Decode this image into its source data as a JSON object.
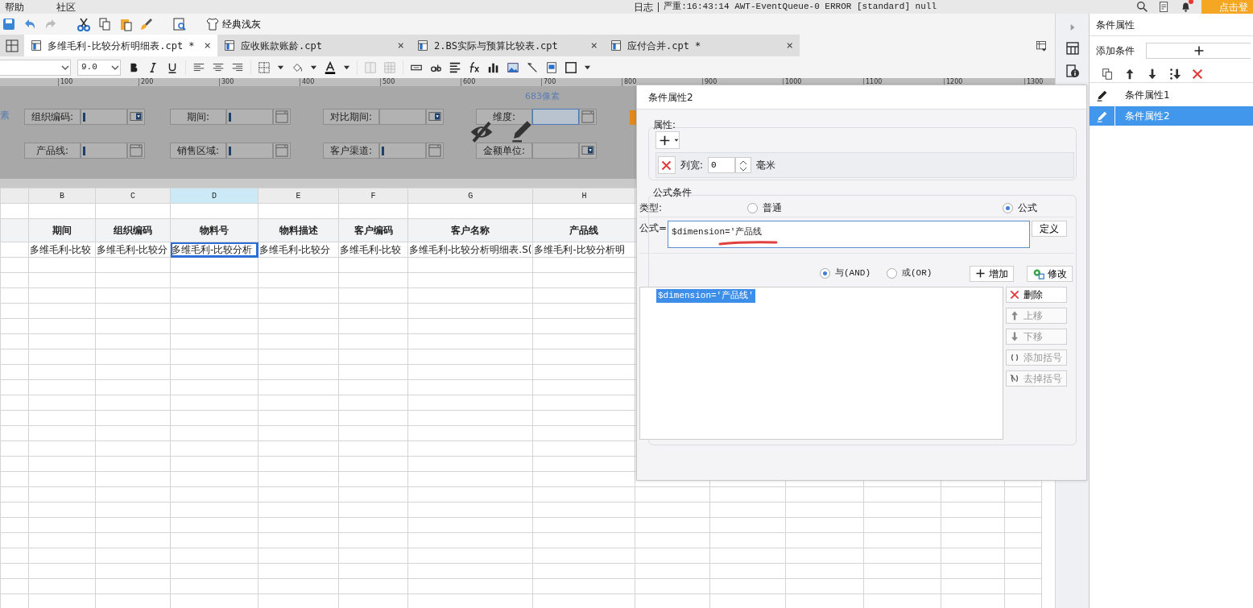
{
  "menu": [
    {
      "label": "帮助"
    },
    {
      "label": "社区"
    }
  ],
  "log": {
    "label": "日志",
    "message": "严重:16:43:14 AWT-EventQueue-0 ERROR [standard] null"
  },
  "notification": {
    "unread": true
  },
  "login_button": "点击登",
  "toolbar": {
    "redo_disabled": true,
    "theme": "经典浅灰"
  },
  "tabs": [
    {
      "label": "多维毛利-比较分析明细表.cpt *",
      "close": "×",
      "selected": true
    },
    {
      "label": "应收账款账龄.cpt",
      "close": "×",
      "selected": false
    },
    {
      "label": "2.BS实际与预算比较表.cpt",
      "close": "×",
      "selected": false
    },
    {
      "label": "应付合并.cpt *",
      "close": "×",
      "selected": false
    }
  ],
  "format": {
    "font_size": "9.0"
  },
  "ruler": [
    "100",
    "200",
    "300",
    "400",
    "500",
    "600",
    "700",
    "800",
    "900",
    "1000",
    "1100",
    "1200",
    "1300"
  ],
  "parameters": {
    "edge_text": "素",
    "size_hint": "683像素",
    "fields": [
      {
        "label": "组织编码:",
        "kind": "combo",
        "selected": false
      },
      {
        "label": "期间:",
        "kind": "date",
        "selected": false
      },
      {
        "label": "对比期间:",
        "kind": "combo",
        "selected": false
      },
      {
        "label": "维度:",
        "kind": "date",
        "selected": true
      },
      {
        "label": "产品线:",
        "kind": "date",
        "selected": false
      },
      {
        "label": "销售区域:",
        "kind": "date",
        "selected": false
      },
      {
        "label": "客户渠道:",
        "kind": "date",
        "selected": false
      },
      {
        "label": "金额单位:",
        "kind": "combo",
        "selected": false
      }
    ]
  },
  "sheet": {
    "columns": [
      {
        "letter": "B",
        "selected": false
      },
      {
        "letter": "C",
        "selected": false
      },
      {
        "letter": "D",
        "selected": true
      },
      {
        "letter": "E",
        "selected": false
      },
      {
        "letter": "F",
        "selected": false
      },
      {
        "letter": "G",
        "selected": false
      },
      {
        "letter": "H",
        "selected": false
      }
    ],
    "headers": [
      "期间",
      "组织编码",
      "物料号",
      "物料描述",
      "客户编码",
      "客户名称",
      "产品线"
    ],
    "data_row": [
      {
        "text": "多维毛利-比较",
        "selected": false
      },
      {
        "text": "多维毛利-比较分",
        "selected": false
      },
      {
        "text": "多维毛利-比较分析",
        "selected": true
      },
      {
        "text": "多维毛利-比较分",
        "selected": false
      },
      {
        "text": "多维毛利-比较",
        "selected": false
      },
      {
        "text": "多维毛利-比较分析明细表.S(",
        "selected": false
      },
      {
        "text": "多维毛利-比较分析明",
        "selected": false
      }
    ]
  },
  "dialog": {
    "title": "条件属性2",
    "property_section": "属性:",
    "column_width": {
      "label": "列宽:",
      "value": "0",
      "unit": "毫米"
    },
    "formula_section": "公式条件",
    "type_label": "类型:",
    "types": [
      {
        "label": "普通",
        "selected": false
      },
      {
        "label": "公式",
        "selected": true
      }
    ],
    "formula_label": "公式=",
    "formula": "$dimension='产品线",
    "define_button": "定义",
    "joins": [
      {
        "label": "与(AND)",
        "selected": true
      },
      {
        "label": "或(OR)",
        "selected": false
      }
    ],
    "add_button": "增加",
    "modify_button": "修改",
    "conditions": [
      {
        "text": "$dimension='产品线'",
        "selected": true
      }
    ],
    "side_buttons": [
      {
        "label": "删除",
        "kind": "delete",
        "disabled": false
      },
      {
        "label": "上移",
        "kind": "up",
        "disabled": true
      },
      {
        "label": "下移",
        "kind": "down",
        "disabled": true
      },
      {
        "label": "添加括号",
        "kind": "bracket",
        "disabled": true
      },
      {
        "label": "去掉括号",
        "kind": "unbracket",
        "disabled": true
      }
    ]
  },
  "side_panel": {
    "title": "条件属性",
    "add_label": "添加条件",
    "items": [
      {
        "label": "条件属性1",
        "selected": false
      },
      {
        "label": "条件属性2",
        "selected": true
      }
    ]
  }
}
